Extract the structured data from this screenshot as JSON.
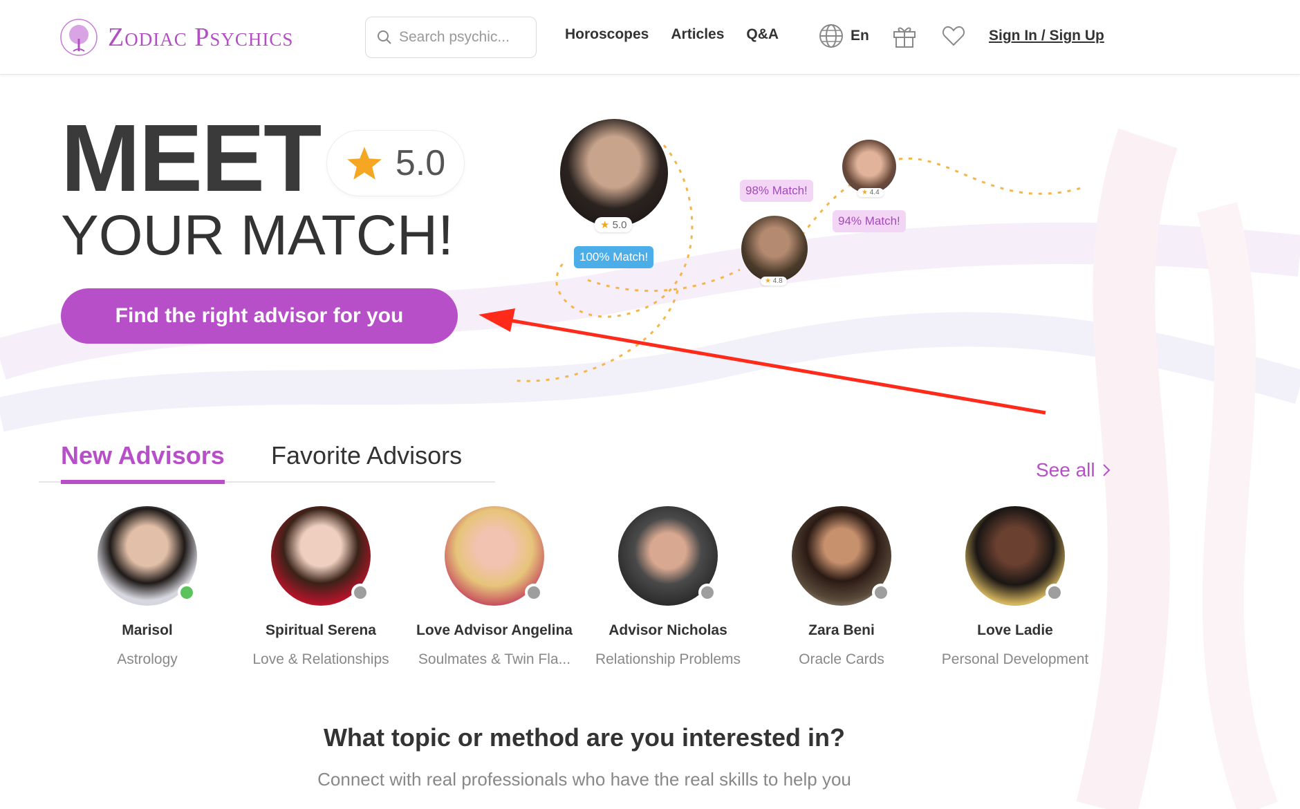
{
  "header": {
    "logo_text": "Zodiac Psychics",
    "search_placeholder": "Search psychic...",
    "nav": [
      "Horoscopes",
      "Articles",
      "Q&A"
    ],
    "language": "En",
    "signin": "Sign In / Sign Up"
  },
  "hero": {
    "title": "MEET",
    "rating": "5.0",
    "subtitle": "YOUR MATCH!",
    "cta": "Find the right advisor for you"
  },
  "matches": {
    "main_rating": "5.0",
    "main_badge": "100% Match!",
    "badge_98": "98% Match!",
    "badge_94": "94% Match!",
    "small_rating_a": "4.4",
    "small_rating_b": "4.8"
  },
  "tabs": {
    "new": "New Advisors",
    "favorite": "Favorite Advisors",
    "see_all": "See all"
  },
  "advisors": [
    {
      "name": "Marisol",
      "category": "Astrology",
      "status": "online"
    },
    {
      "name": "Spiritual Serena",
      "category": "Love & Relationships",
      "status": "offline"
    },
    {
      "name": "Love Advisor Angelina",
      "category": "Soulmates & Twin Fla...",
      "status": "offline"
    },
    {
      "name": "Advisor Nicholas",
      "category": "Relationship Problems",
      "status": "offline"
    },
    {
      "name": "Zara Beni",
      "category": "Oracle Cards",
      "status": "offline"
    },
    {
      "name": "Love Ladie",
      "category": "Personal Development",
      "status": "offline"
    }
  ],
  "topics": {
    "title": "What topic or method are you interested in?",
    "subtitle": "Connect with real professionals who have the real skills to help you"
  },
  "colors": {
    "brand": "#b74fc9",
    "online": "#5cc35c",
    "offline": "#9e9e9e",
    "match_blue": "#4baee8",
    "arrow": "#ff2a1a"
  }
}
